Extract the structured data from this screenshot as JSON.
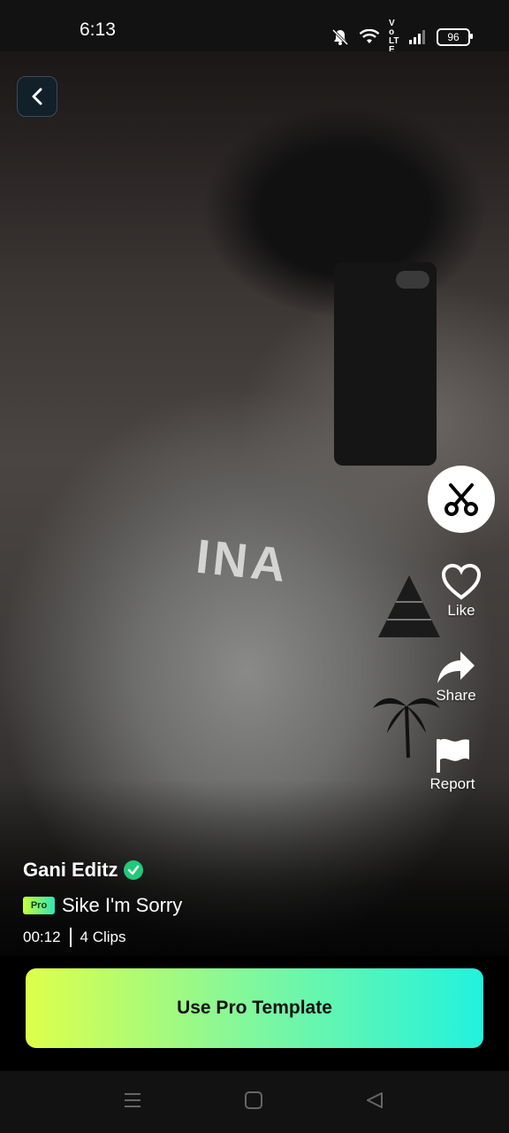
{
  "status_bar": {
    "time": "6:13",
    "volte": "Vo LTE",
    "battery": "96"
  },
  "video": {
    "shirt_text": "INA"
  },
  "actions": {
    "like_label": "Like",
    "share_label": "Share",
    "report_label": "Report"
  },
  "template": {
    "creator_name": "Gani Editz",
    "pro_badge": "Pro",
    "title": "Sike I'm Sorry",
    "duration": "00:12",
    "clips": "4 Clips"
  },
  "cta": {
    "label": "Use Pro Template"
  },
  "colors": {
    "accent_start": "#deff4a",
    "accent_end": "#22f2dd",
    "verified": "#21c97a"
  }
}
